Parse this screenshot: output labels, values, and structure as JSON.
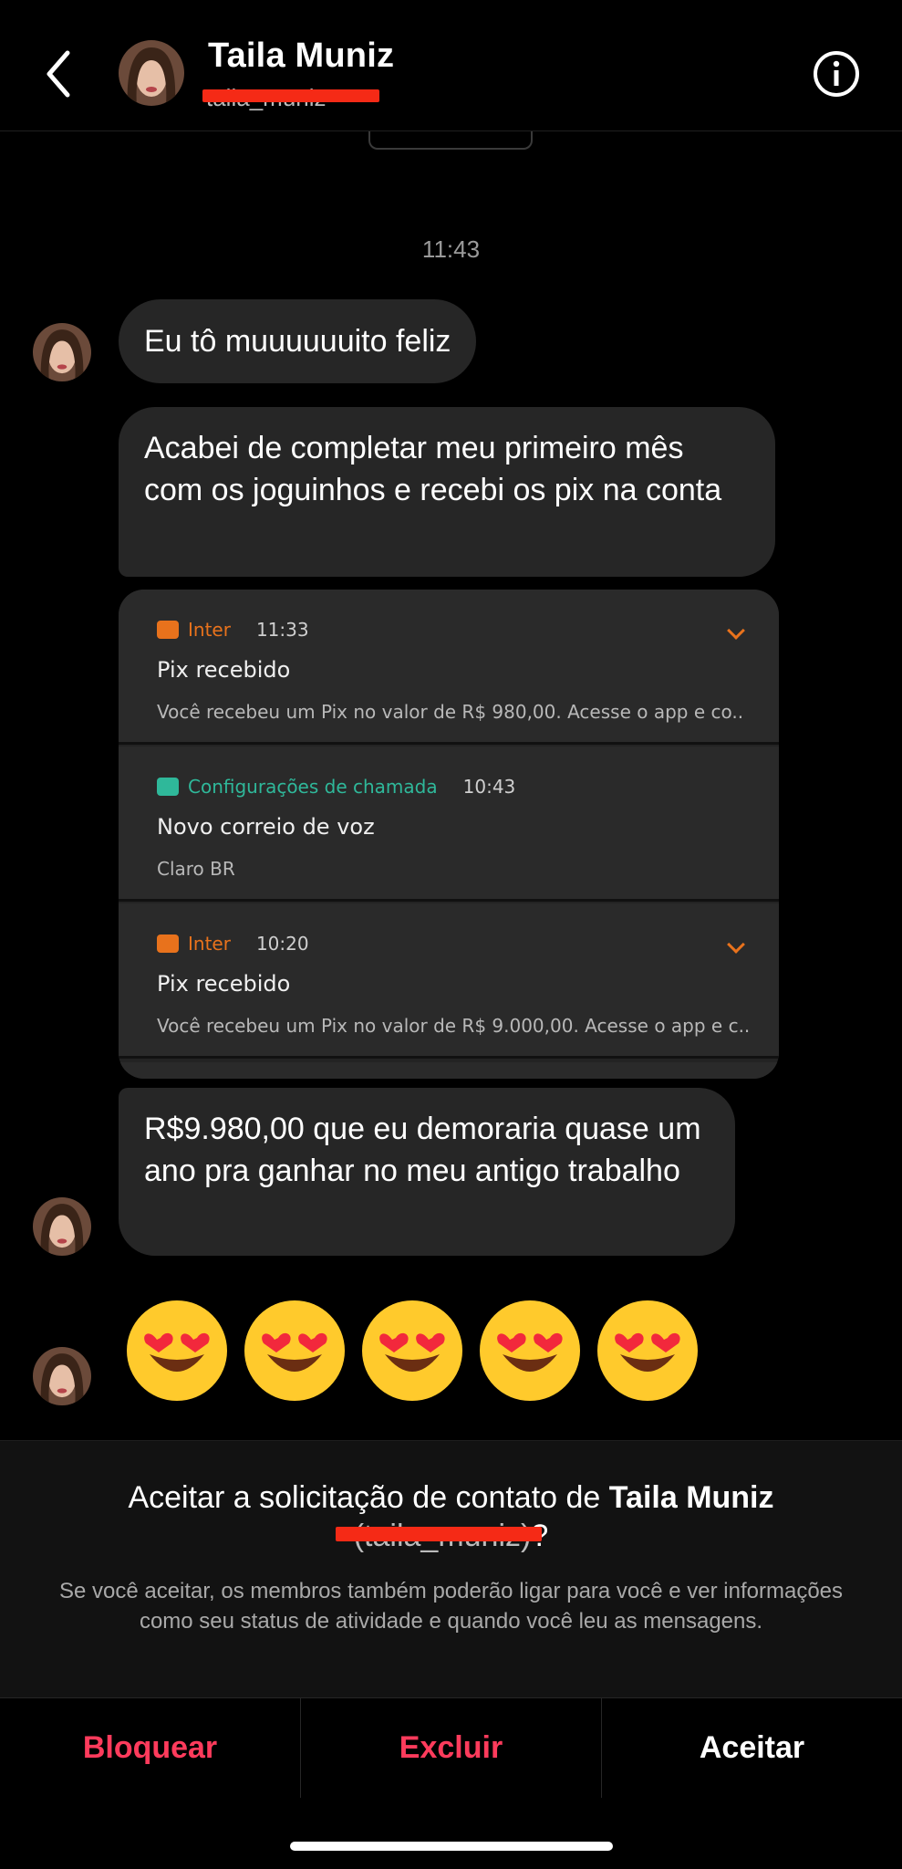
{
  "header": {
    "name": "Taila Muniz",
    "username": "taila_muniz",
    "back_icon": "chevron-left-icon",
    "info_icon": "info-icon"
  },
  "chat": {
    "timestamp": "11:43",
    "msg1": "Eu tô muuuuuuito feliz",
    "msg2": "Acabei de completar meu primeiro mês com os joguinhos e recebi os pix na conta",
    "msg3": "R$9.980,00 que eu demoraria quase um ano pra ganhar no meu antigo trabalho",
    "emojis": [
      "heart-eyes",
      "heart-eyes",
      "heart-eyes",
      "heart-eyes",
      "heart-eyes"
    ]
  },
  "screenshot": {
    "notifications": [
      {
        "app": "Inter",
        "time": "11:33",
        "title": "Pix recebido",
        "body": "Você recebeu um Pix no valor de R$ 980,00. Acesse o app e co..",
        "color": "#e8721c"
      },
      {
        "app": "Configurações de chamada",
        "time": "10:43",
        "title": "Novo correio de voz",
        "body": "Claro BR",
        "color": "#2fb89a"
      },
      {
        "app": "Inter",
        "time": "10:20",
        "title": "Pix recebido",
        "body": "Você recebeu um Pix no valor de R$ 9.000,00. Acesse o app e c..",
        "color": "#e8721c"
      }
    ]
  },
  "request": {
    "prefix": "Aceitar a solicitação de contato de ",
    "name": "Taila Muniz",
    "user": "(taila_muniz)",
    "suffix": "?",
    "text": "Se você aceitar, os membros também poderão ligar para você e ver informações como seu status de atividade e quando você leu as mensagens."
  },
  "actions": {
    "block": "Bloquear",
    "delete": "Excluir",
    "accept": "Aceitar"
  },
  "colors": {
    "danger": "#ff3b5c",
    "bubble": "#262626",
    "redaction": "#f52a16"
  }
}
